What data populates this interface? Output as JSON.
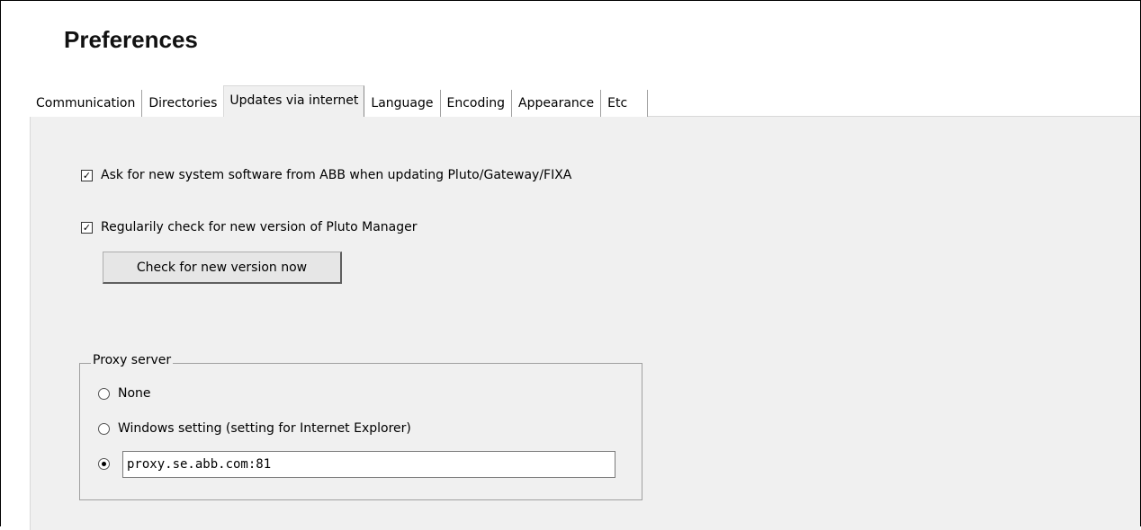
{
  "dialog": {
    "title": "Preferences"
  },
  "tabs": [
    {
      "label": "Communication"
    },
    {
      "label": "Directories"
    },
    {
      "label": "Updates via internet",
      "active": true
    },
    {
      "label": "Language"
    },
    {
      "label": "Encoding"
    },
    {
      "label": "Appearance"
    },
    {
      "label": "Etc"
    }
  ],
  "updates": {
    "ask_system_software": {
      "label": "Ask for new system software from ABB when updating Pluto/Gateway/FIXA",
      "checked": true
    },
    "regular_check": {
      "label": "Regularily check for new version of Pluto Manager",
      "checked": true
    },
    "check_now_button": "Check for new version now"
  },
  "proxy": {
    "legend": "Proxy server",
    "options": [
      {
        "label": "None",
        "selected": false
      },
      {
        "label": "Windows setting (setting for Internet Explorer)",
        "selected": false
      },
      {
        "label": "",
        "selected": true
      }
    ],
    "custom_value": "proxy.se.abb.com:81"
  }
}
